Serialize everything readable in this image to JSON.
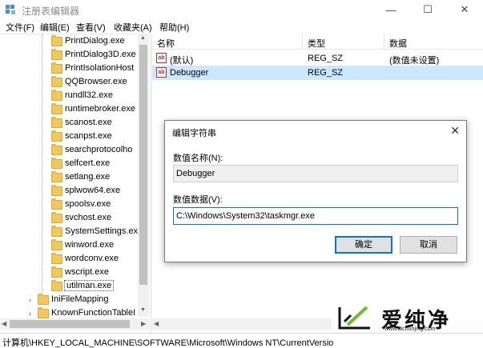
{
  "window": {
    "title": "注册表编辑器",
    "controls": {
      "minimize": "—",
      "maximize": "☐",
      "close": "✕"
    }
  },
  "menu": {
    "items": [
      "文件(F)",
      "编辑(E)",
      "查看(V)",
      "收藏夹(A)",
      "帮助(H)"
    ]
  },
  "tree": {
    "items": [
      {
        "label": "PrintDialog.exe",
        "selected": false
      },
      {
        "label": "PrintDialog3D.exe",
        "selected": false
      },
      {
        "label": "PrintIsolationHost",
        "selected": false
      },
      {
        "label": "QQBrowser.exe",
        "selected": false
      },
      {
        "label": "rundll32.exe",
        "selected": false
      },
      {
        "label": "runtimebroker.exe",
        "selected": false
      },
      {
        "label": "scanost.exe",
        "selected": false
      },
      {
        "label": "scanpst.exe",
        "selected": false
      },
      {
        "label": "searchprotocolho",
        "selected": false
      },
      {
        "label": "selfcert.exe",
        "selected": false
      },
      {
        "label": "setlang.exe",
        "selected": false
      },
      {
        "label": "splwow64.exe",
        "selected": false
      },
      {
        "label": "spoolsv.exe",
        "selected": false
      },
      {
        "label": "svchost.exe",
        "selected": false
      },
      {
        "label": "SystemSettings.ex",
        "selected": false
      },
      {
        "label": "winword.exe",
        "selected": false
      },
      {
        "label": "wordconv.exe",
        "selected": false
      },
      {
        "label": "wscript.exe",
        "selected": false
      },
      {
        "label": "utilman.exe",
        "selected": true
      }
    ],
    "parent_items": [
      {
        "label": "IniFileMapping",
        "expander": "›"
      },
      {
        "label": "KnownFunctionTableI",
        "expander": "›"
      }
    ]
  },
  "list": {
    "columns": [
      "名称",
      "类型",
      "数据"
    ],
    "rows": [
      {
        "icon": "ab",
        "name": "(默认)",
        "type": "REG_SZ",
        "data": "(数值未设置)",
        "selected": false
      },
      {
        "icon": "ab",
        "name": "Debugger",
        "type": "REG_SZ",
        "data": "",
        "selected": true
      }
    ]
  },
  "statusbar": {
    "path": "计算机\\HKEY_LOCAL_MACHINE\\SOFTWARE\\Microsoft\\Windows NT\\CurrentVersio"
  },
  "dialog": {
    "title": "编辑字符串",
    "close": "✕",
    "name_label": "数值名称(N):",
    "name_value": "Debugger",
    "data_label": "数值数据(V):",
    "data_value": "C:\\Windows\\System32\\taskmgr.exe",
    "ok_label": "确定",
    "cancel_label": "取消"
  },
  "watermark": {
    "text": "爱纯净",
    "url": "www.aichunjing.com"
  },
  "colors": {
    "selection": "#cce8ff",
    "accent": "#0078d7",
    "folder": "#f0c95a"
  }
}
